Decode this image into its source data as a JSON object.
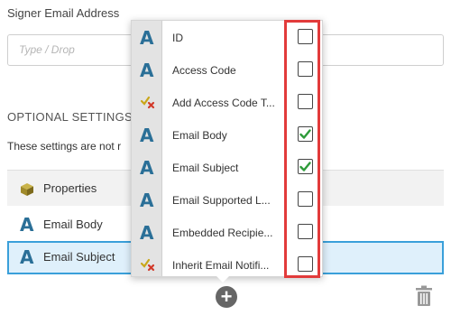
{
  "signer_email": {
    "label": "Signer Email Address",
    "placeholder": "Type / Drop"
  },
  "optional_settings": {
    "title": "OPTIONAL SETTINGS",
    "note": "These settings are not r"
  },
  "properties": {
    "label": "Properties",
    "icon": "cube-icon"
  },
  "rows": [
    {
      "label": "Email Body",
      "icon": "text-a-icon",
      "selected": false
    },
    {
      "label": "Email Subject",
      "icon": "text-a-icon",
      "selected": true
    }
  ],
  "dropdown": {
    "items": [
      {
        "label": "ID",
        "icon": "text-a-icon",
        "checked": false
      },
      {
        "label": "Access Code",
        "icon": "text-a-icon",
        "checked": false
      },
      {
        "label": "Add Access Code T...",
        "icon": "boolean-check-x-icon",
        "checked": false
      },
      {
        "label": "Email Body",
        "icon": "text-a-icon",
        "checked": true
      },
      {
        "label": "Email Subject",
        "icon": "text-a-icon",
        "checked": true
      },
      {
        "label": "Email Supported L...",
        "icon": "text-a-icon",
        "checked": false
      },
      {
        "label": "Embedded Recipie...",
        "icon": "text-a-icon",
        "checked": false
      },
      {
        "label": "Inherit Email Notifi...",
        "icon": "boolean-check-x-icon",
        "checked": false
      }
    ]
  },
  "colors": {
    "accent": "#3aa0da",
    "check": "#2e9b3a",
    "highlight": "#e23b3b",
    "icon_blue": "#2a6f97"
  }
}
